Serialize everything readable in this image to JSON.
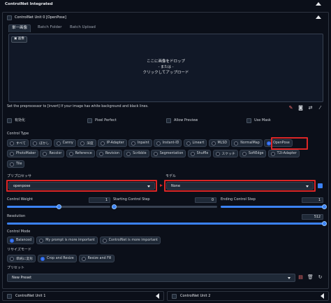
{
  "header": {
    "title": "ControlNet Integrated"
  },
  "unit": {
    "title": "ControlNet Unit 0 [OpenPose]",
    "tabs": [
      {
        "label": "単一画像",
        "active": true
      },
      {
        "label": "Batch Folder",
        "active": false
      },
      {
        "label": "Batch Upload",
        "active": false
      }
    ],
    "image_badge": "画像",
    "dropzone": {
      "line1": "ここに画像をドロップ",
      "line2": "- または -",
      "line3": "クリックしてアップロード"
    },
    "invert_hint": "Set the preprocessor to [invert] If your image has white background and black lines.",
    "tool_icons": [
      "edit-icon",
      "camera-icon",
      "swap-icon",
      "brush-icon"
    ]
  },
  "options": {
    "enable": {
      "label": "有効化",
      "checked": false
    },
    "pixel_perfect": {
      "label": "Pixel Perfect",
      "checked": false
    },
    "allow_preview": {
      "label": "Allow Preview",
      "checked": false
    },
    "use_mask": {
      "label": "Use Mask",
      "checked": false
    }
  },
  "control_type": {
    "label": "Control Type",
    "selected": "OpenPose",
    "row1": [
      "すべて",
      "ぼかし",
      "Canny",
      "深度",
      "IP-Adapter",
      "Inpaint",
      "Instant-ID",
      "Lineart",
      "MLSD",
      "NormalMap",
      "OpenPose"
    ],
    "row2": [
      "PhotoMaker",
      "Recolor",
      "Reference",
      "Revision",
      "Scribble",
      "Segmentation",
      "Shuffle",
      "スケッチ",
      "SoftEdge",
      "T2I-Adapter"
    ],
    "row3": [
      "Tile"
    ]
  },
  "preprocessor": {
    "label": "プリプロセッサ",
    "value": "openpose"
  },
  "model": {
    "label": "モデル",
    "value": "None"
  },
  "sliders": {
    "control_weight": {
      "label": "Control Weight",
      "value": "1",
      "fraction": 0.5
    },
    "starting_step": {
      "label": "Starting Control Step",
      "value": "0",
      "fraction": 0.0
    },
    "ending_step": {
      "label": "Ending Control Step",
      "value": "1",
      "fraction": 1.0
    },
    "resolution": {
      "label": "Resolution",
      "value": "512",
      "fraction": 1.0
    }
  },
  "control_mode": {
    "label": "Control Mode",
    "selected": "Balanced",
    "options": [
      "Balanced",
      "My prompt is more important",
      "ControlNet is more important"
    ]
  },
  "resize_mode": {
    "label": "リサイズモード",
    "selected": "Crop and Resize",
    "options": [
      "単純に変形",
      "Crop and Resize",
      "Resize and Fill"
    ]
  },
  "preset": {
    "label": "プリセット",
    "value": "New Preset"
  },
  "footer": {
    "unit1": "ControlNet Unit 1",
    "unit2": "ControlNet Unit 2"
  },
  "colors": {
    "accent": "#3b82f6",
    "highlight": "#dc2626",
    "background": "#0b0f19"
  }
}
